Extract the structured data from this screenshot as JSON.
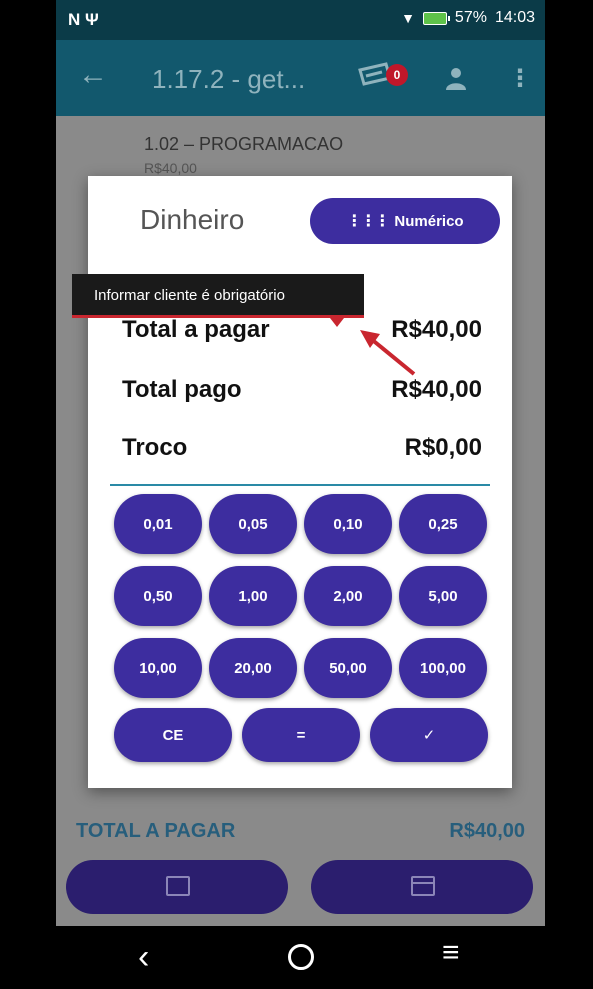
{
  "status_bar": {
    "left": "N Ψ",
    "battery": "57%",
    "time": "14:03"
  },
  "toolbar": {
    "title": "1.17.2 - get...",
    "cart_count": "0"
  },
  "background_item": {
    "name": "1.02 – PROGRAMACAO",
    "price": "R$40,00"
  },
  "background_footer": {
    "total_label": "TOTAL A PAGAR",
    "total_value": "R$40,00"
  },
  "dialog": {
    "title": "Dinheiro",
    "numeric_label": "Numérico",
    "rows": [
      {
        "label": "Total a pagar",
        "value": "R$40,00"
      },
      {
        "label": "Total pago",
        "value": "R$40,00"
      },
      {
        "label": "Troco",
        "value": "R$0,00"
      }
    ],
    "keys": [
      "0,01",
      "0,05",
      "0,10",
      "0,25",
      "0,50",
      "1,00",
      "2,00",
      "5,00",
      "10,00",
      "20,00",
      "50,00",
      "100,00"
    ],
    "ce_label": "CE",
    "equals_label": "=",
    "confirm_label": "✓"
  },
  "tooltip": {
    "text": "Informar cliente é obrigatório"
  },
  "colors": {
    "primary": "#3d2d9f",
    "toolbar": "#12586d",
    "error": "#c9262f"
  }
}
